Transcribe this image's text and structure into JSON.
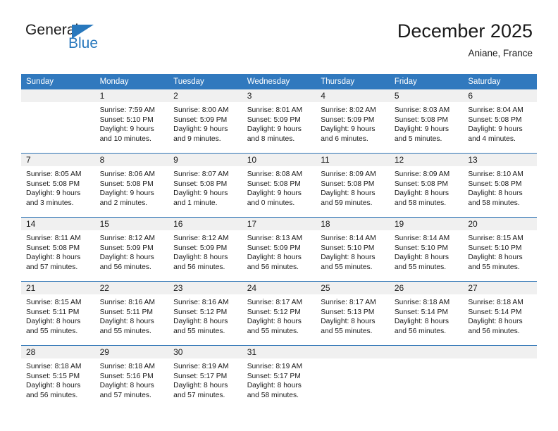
{
  "brand": {
    "name_top": "General",
    "name_bottom": "Blue",
    "triangle_icon": "triangle-icon",
    "accent_color": "#2878bd"
  },
  "header": {
    "title": "December 2025",
    "subtitle": "Aniane, France"
  },
  "calendar": {
    "header_color": "#3179be",
    "separator_color": "#2e74b5",
    "daynum_band_color": "#f0f0f0",
    "weekday_headers": [
      "Sunday",
      "Monday",
      "Tuesday",
      "Wednesday",
      "Thursday",
      "Friday",
      "Saturday"
    ],
    "weeks": [
      [
        {
          "day": "",
          "lines": []
        },
        {
          "day": "1",
          "lines": [
            "Sunrise: 7:59 AM",
            "Sunset: 5:10 PM",
            "Daylight: 9 hours",
            "and 10 minutes."
          ]
        },
        {
          "day": "2",
          "lines": [
            "Sunrise: 8:00 AM",
            "Sunset: 5:09 PM",
            "Daylight: 9 hours",
            "and 9 minutes."
          ]
        },
        {
          "day": "3",
          "lines": [
            "Sunrise: 8:01 AM",
            "Sunset: 5:09 PM",
            "Daylight: 9 hours",
            "and 8 minutes."
          ]
        },
        {
          "day": "4",
          "lines": [
            "Sunrise: 8:02 AM",
            "Sunset: 5:09 PM",
            "Daylight: 9 hours",
            "and 6 minutes."
          ]
        },
        {
          "day": "5",
          "lines": [
            "Sunrise: 8:03 AM",
            "Sunset: 5:08 PM",
            "Daylight: 9 hours",
            "and 5 minutes."
          ]
        },
        {
          "day": "6",
          "lines": [
            "Sunrise: 8:04 AM",
            "Sunset: 5:08 PM",
            "Daylight: 9 hours",
            "and 4 minutes."
          ]
        }
      ],
      [
        {
          "day": "7",
          "lines": [
            "Sunrise: 8:05 AM",
            "Sunset: 5:08 PM",
            "Daylight: 9 hours",
            "and 3 minutes."
          ]
        },
        {
          "day": "8",
          "lines": [
            "Sunrise: 8:06 AM",
            "Sunset: 5:08 PM",
            "Daylight: 9 hours",
            "and 2 minutes."
          ]
        },
        {
          "day": "9",
          "lines": [
            "Sunrise: 8:07 AM",
            "Sunset: 5:08 PM",
            "Daylight: 9 hours",
            "and 1 minute."
          ]
        },
        {
          "day": "10",
          "lines": [
            "Sunrise: 8:08 AM",
            "Sunset: 5:08 PM",
            "Daylight: 9 hours",
            "and 0 minutes."
          ]
        },
        {
          "day": "11",
          "lines": [
            "Sunrise: 8:09 AM",
            "Sunset: 5:08 PM",
            "Daylight: 8 hours",
            "and 59 minutes."
          ]
        },
        {
          "day": "12",
          "lines": [
            "Sunrise: 8:09 AM",
            "Sunset: 5:08 PM",
            "Daylight: 8 hours",
            "and 58 minutes."
          ]
        },
        {
          "day": "13",
          "lines": [
            "Sunrise: 8:10 AM",
            "Sunset: 5:08 PM",
            "Daylight: 8 hours",
            "and 58 minutes."
          ]
        }
      ],
      [
        {
          "day": "14",
          "lines": [
            "Sunrise: 8:11 AM",
            "Sunset: 5:08 PM",
            "Daylight: 8 hours",
            "and 57 minutes."
          ]
        },
        {
          "day": "15",
          "lines": [
            "Sunrise: 8:12 AM",
            "Sunset: 5:09 PM",
            "Daylight: 8 hours",
            "and 56 minutes."
          ]
        },
        {
          "day": "16",
          "lines": [
            "Sunrise: 8:12 AM",
            "Sunset: 5:09 PM",
            "Daylight: 8 hours",
            "and 56 minutes."
          ]
        },
        {
          "day": "17",
          "lines": [
            "Sunrise: 8:13 AM",
            "Sunset: 5:09 PM",
            "Daylight: 8 hours",
            "and 56 minutes."
          ]
        },
        {
          "day": "18",
          "lines": [
            "Sunrise: 8:14 AM",
            "Sunset: 5:10 PM",
            "Daylight: 8 hours",
            "and 55 minutes."
          ]
        },
        {
          "day": "19",
          "lines": [
            "Sunrise: 8:14 AM",
            "Sunset: 5:10 PM",
            "Daylight: 8 hours",
            "and 55 minutes."
          ]
        },
        {
          "day": "20",
          "lines": [
            "Sunrise: 8:15 AM",
            "Sunset: 5:10 PM",
            "Daylight: 8 hours",
            "and 55 minutes."
          ]
        }
      ],
      [
        {
          "day": "21",
          "lines": [
            "Sunrise: 8:15 AM",
            "Sunset: 5:11 PM",
            "Daylight: 8 hours",
            "and 55 minutes."
          ]
        },
        {
          "day": "22",
          "lines": [
            "Sunrise: 8:16 AM",
            "Sunset: 5:11 PM",
            "Daylight: 8 hours",
            "and 55 minutes."
          ]
        },
        {
          "day": "23",
          "lines": [
            "Sunrise: 8:16 AM",
            "Sunset: 5:12 PM",
            "Daylight: 8 hours",
            "and 55 minutes."
          ]
        },
        {
          "day": "24",
          "lines": [
            "Sunrise: 8:17 AM",
            "Sunset: 5:12 PM",
            "Daylight: 8 hours",
            "and 55 minutes."
          ]
        },
        {
          "day": "25",
          "lines": [
            "Sunrise: 8:17 AM",
            "Sunset: 5:13 PM",
            "Daylight: 8 hours",
            "and 55 minutes."
          ]
        },
        {
          "day": "26",
          "lines": [
            "Sunrise: 8:18 AM",
            "Sunset: 5:14 PM",
            "Daylight: 8 hours",
            "and 56 minutes."
          ]
        },
        {
          "day": "27",
          "lines": [
            "Sunrise: 8:18 AM",
            "Sunset: 5:14 PM",
            "Daylight: 8 hours",
            "and 56 minutes."
          ]
        }
      ],
      [
        {
          "day": "28",
          "lines": [
            "Sunrise: 8:18 AM",
            "Sunset: 5:15 PM",
            "Daylight: 8 hours",
            "and 56 minutes."
          ]
        },
        {
          "day": "29",
          "lines": [
            "Sunrise: 8:18 AM",
            "Sunset: 5:16 PM",
            "Daylight: 8 hours",
            "and 57 minutes."
          ]
        },
        {
          "day": "30",
          "lines": [
            "Sunrise: 8:19 AM",
            "Sunset: 5:17 PM",
            "Daylight: 8 hours",
            "and 57 minutes."
          ]
        },
        {
          "day": "31",
          "lines": [
            "Sunrise: 8:19 AM",
            "Sunset: 5:17 PM",
            "Daylight: 8 hours",
            "and 58 minutes."
          ]
        },
        {
          "day": "",
          "lines": []
        },
        {
          "day": "",
          "lines": []
        },
        {
          "day": "",
          "lines": []
        }
      ]
    ]
  }
}
